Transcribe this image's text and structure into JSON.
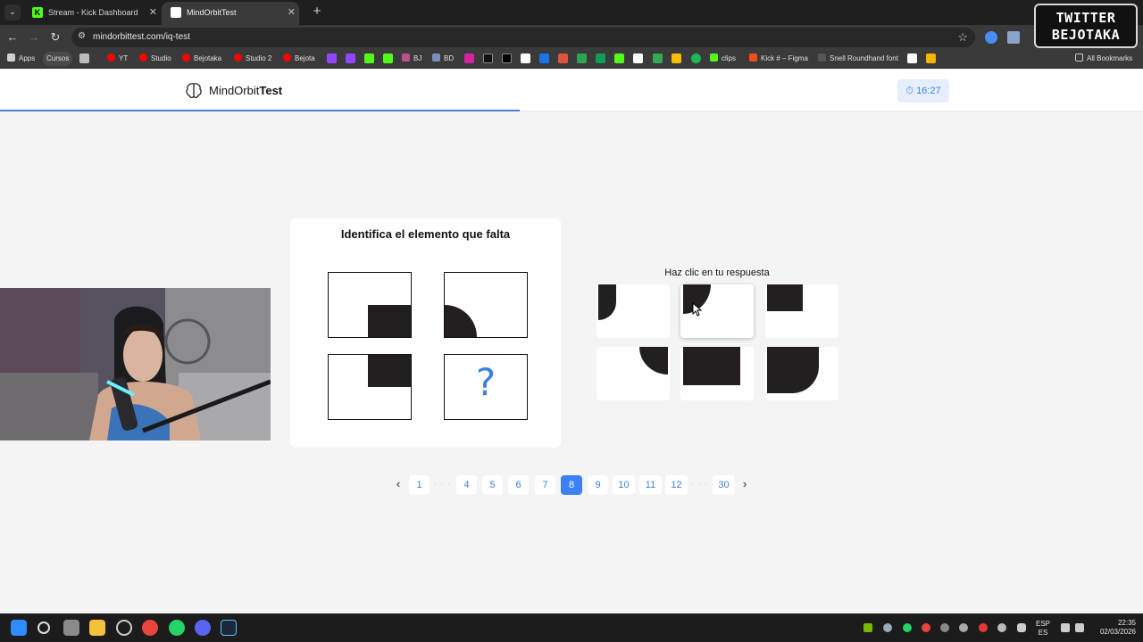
{
  "browser": {
    "tabs": [
      {
        "title": "Stream - Kick Dashboard",
        "favicon": "kick-icon",
        "active": false
      },
      {
        "title": "MindOrbitTest",
        "favicon": "mindorbit-icon",
        "active": true
      }
    ],
    "close_glyph": "✕",
    "new_tab_glyph": "+",
    "url": "mindorbittest.com/iq-test",
    "bookmarks": [
      {
        "label": "Apps",
        "icon": "apps-grid-icon"
      },
      {
        "label": "Cursos",
        "icon": "folder-icon"
      },
      {
        "label": "YT",
        "icon": "youtube-icon"
      },
      {
        "label": "Studio",
        "icon": "youtube-icon"
      },
      {
        "label": "Bejotaka",
        "icon": "youtube-icon"
      },
      {
        "label": "Studio 2",
        "icon": "youtube-icon"
      },
      {
        "label": "Bejota",
        "icon": "youtube-icon"
      },
      {
        "label": "BJ",
        "icon": "bookmark-icon"
      },
      {
        "label": "BD",
        "icon": "bookmark-icon"
      },
      {
        "label": "clips",
        "icon": "clips-icon"
      },
      {
        "label": "Kick # – Figma",
        "icon": "figma-icon"
      },
      {
        "label": "Snell Roundhand font",
        "icon": "font-icon"
      },
      {
        "label": "All Bookmarks",
        "icon": "folder-icon"
      }
    ]
  },
  "overlay": {
    "line1": "TWITTER",
    "line2": "BEJOTAKA"
  },
  "site": {
    "logo_light": "MindOrbit",
    "logo_bold": "Test",
    "timer_icon": "⏱",
    "timer": "16:27",
    "progress_fraction": 0.4547
  },
  "question": {
    "title": "Identifica el elemento que falta",
    "missing_glyph": "?"
  },
  "answers": {
    "prompt": "Haz clic en tu respuesta"
  },
  "pagination": {
    "prev_glyph": "‹",
    "next_glyph": "›",
    "ellipsis": "· · ·",
    "pages": [
      "1",
      "4",
      "5",
      "6",
      "7",
      "8",
      "9",
      "10",
      "11",
      "12",
      "30"
    ],
    "current": "8"
  },
  "taskbar": {
    "lang_top": "ESP",
    "lang_bottom": "ES",
    "time": "22:35",
    "date": "02/03/2026"
  },
  "colors": {
    "accent": "#3b82f6",
    "progress": "#4a7fd4",
    "shape_fill": "#231f20"
  }
}
